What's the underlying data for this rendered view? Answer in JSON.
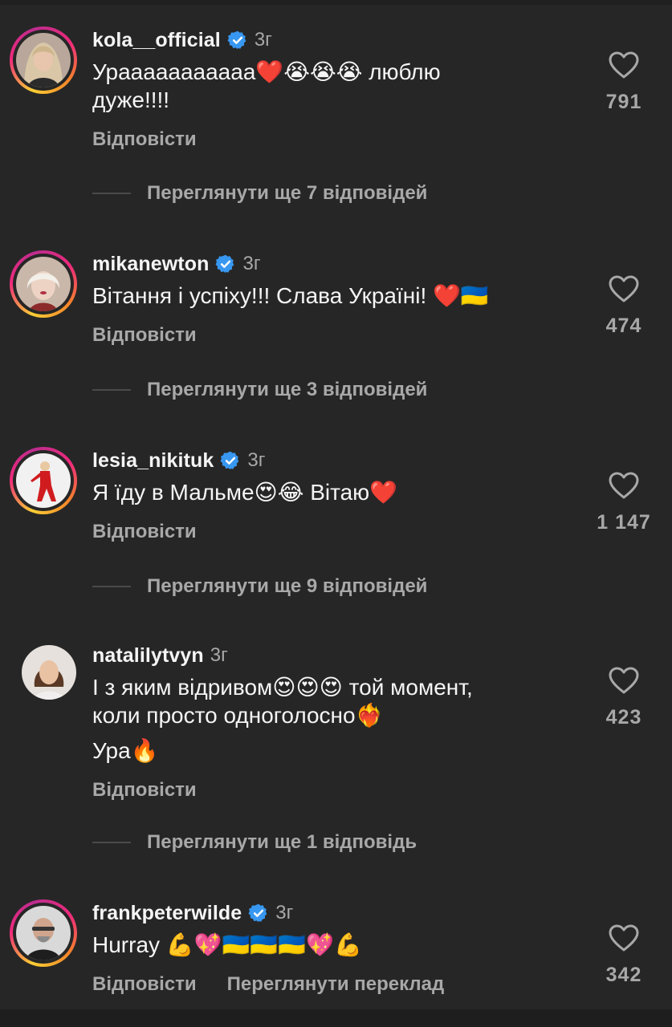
{
  "colors": {
    "background": "#262626",
    "primary_text": "#f5f5f5",
    "secondary_text": "#a8a8a8",
    "verified": "#3897f0",
    "story_ring": [
      "#f9ce34",
      "#ee2a7b",
      "#bd2c8f"
    ]
  },
  "comments": [
    {
      "username": "kola__official",
      "verified": true,
      "time": "3г",
      "text_lines": [
        "Урааааааааааа❤️😭😭😭 люблю",
        "дуже!!!!"
      ],
      "reply_label": "Відповісти",
      "likes": "791",
      "view_replies": "Переглянути ще 7 відповідей"
    },
    {
      "username": "mikanewton",
      "verified": true,
      "time": "3г",
      "text_lines": [
        "Вітання і успіху!!! Слава Україні! ❤️🇺🇦"
      ],
      "reply_label": "Відповісти",
      "likes": "474",
      "view_replies": "Переглянути ще 3 відповідей"
    },
    {
      "username": "lesia_nikituk",
      "verified": true,
      "time": "3г",
      "text_lines": [
        "Я їду в Мальме😍😂 Вітаю❤️"
      ],
      "reply_label": "Відповісти",
      "likes": "1 147",
      "view_replies": "Переглянути ще 9 відповідей"
    },
    {
      "username": "natalilytvyn",
      "verified": false,
      "time": "3г",
      "text_lines": [
        "І з яким відривом😍😍😍 той момент,",
        "коли просто одноголосно❤️‍🔥",
        "Ура🔥"
      ],
      "reply_label": "Відповісти",
      "likes": "423",
      "view_replies": "Переглянути ще 1 відповідь"
    },
    {
      "username": "frankpeterwilde",
      "verified": true,
      "time": "3г",
      "text_lines": [
        "Hurray 💪💖🇺🇦🇺🇦🇺🇦💖💪"
      ],
      "reply_label": "Відповісти",
      "translate_label": "Переглянути переклад",
      "likes": "342"
    }
  ]
}
